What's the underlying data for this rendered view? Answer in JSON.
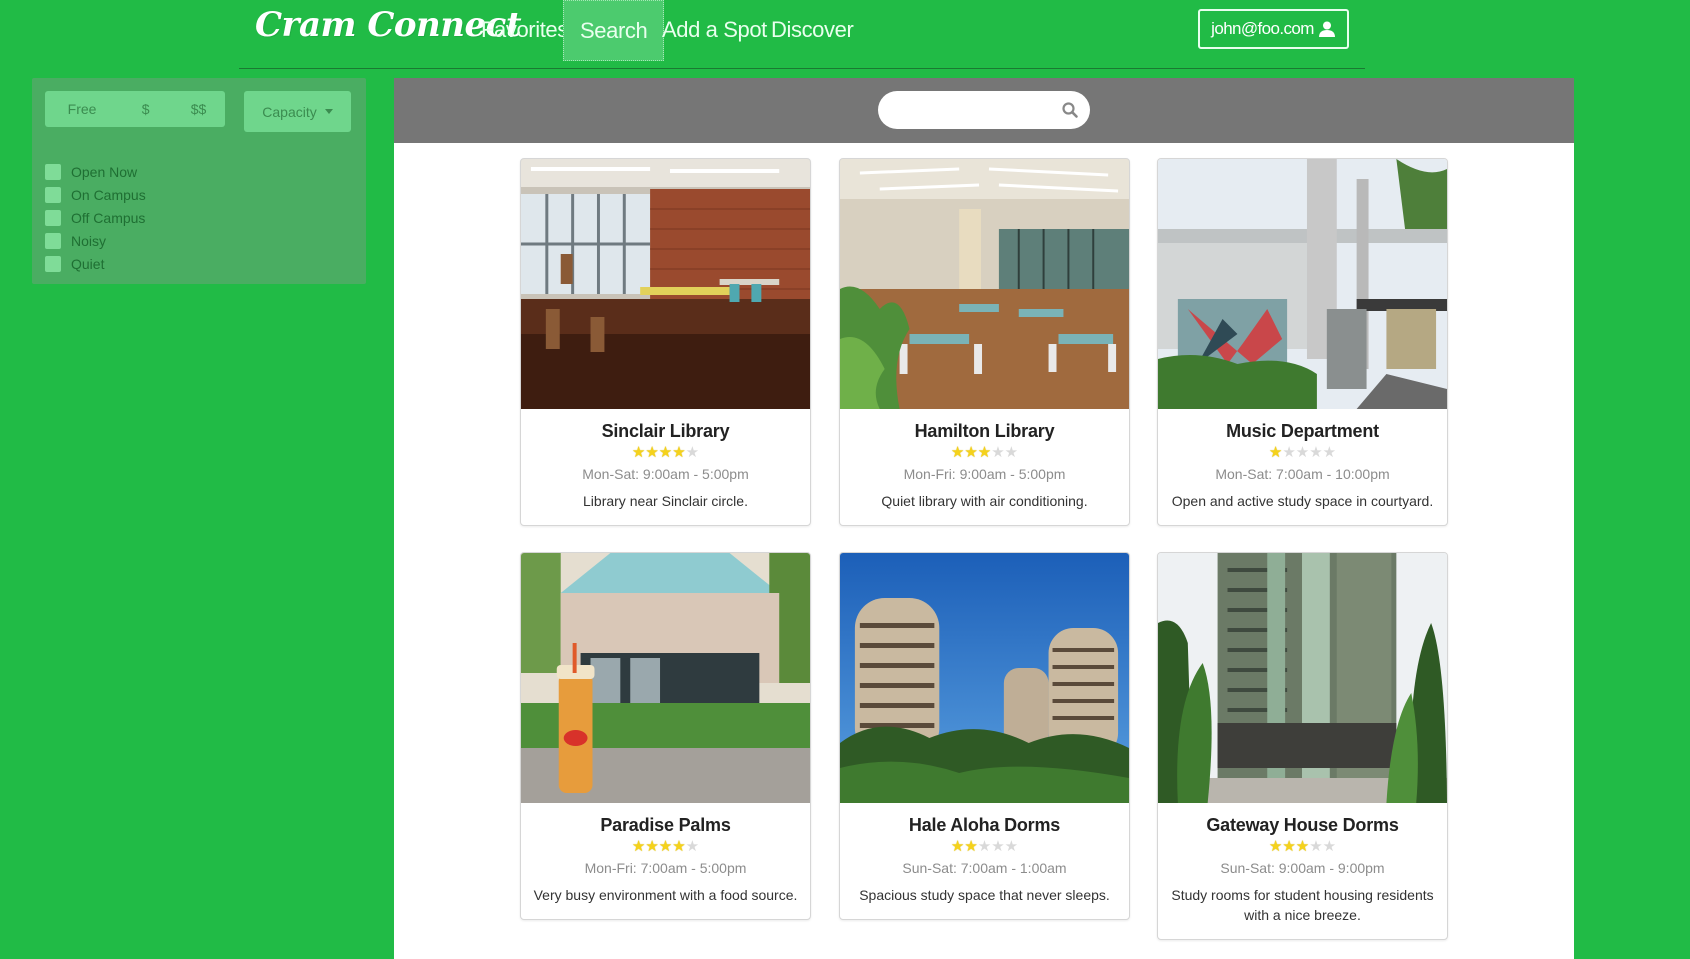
{
  "nav": {
    "brand": "Cram Connect",
    "items": [
      {
        "label": "Favorites"
      },
      {
        "label": "Search"
      },
      {
        "label": "Add a Spot"
      },
      {
        "label": "Discover"
      }
    ],
    "active": "Search",
    "user_email": "john@foo.com"
  },
  "sidebar": {
    "price": [
      "Free",
      "$",
      "$$"
    ],
    "capacity_label": "Capacity",
    "filters": [
      "Open Now",
      "On Campus",
      "Off Campus",
      "Noisy",
      "Quiet"
    ]
  },
  "search": {
    "placeholder": ""
  },
  "cards": [
    {
      "title": "Sinclair Library",
      "rating": 4,
      "hours": "Mon-Sat: 9:00am - 5:00pm",
      "description": "Library near Sinclair circle."
    },
    {
      "title": "Hamilton Library",
      "rating": 3,
      "hours": "Mon-Fri: 9:00am - 5:00pm",
      "description": "Quiet library with air conditioning."
    },
    {
      "title": "Music Department",
      "rating": 1,
      "hours": "Mon-Sat: 7:00am - 10:00pm",
      "description": "Open and active study space in courtyard."
    },
    {
      "title": "Paradise Palms",
      "rating": 4,
      "hours": "Mon-Fri: 7:00am - 5:00pm",
      "description": "Very busy environment with a food source."
    },
    {
      "title": "Hale Aloha Dorms",
      "rating": 2,
      "hours": "Sun-Sat: 7:00am - 1:00am",
      "description": "Spacious study space that never sleeps."
    },
    {
      "title": "Gateway House Dorms",
      "rating": 3,
      "hours": "Sun-Sat: 9:00am - 9:00pm",
      "description": "Study rooms for student housing residents with a nice breeze."
    }
  ],
  "rating_max": 5,
  "colors": {
    "page_bg": "#21bb46",
    "sidebar_bg": "#4aad62",
    "search_bar_bg": "#767676",
    "star_on": "#f5d21b",
    "star_off": "#d9d9d9"
  }
}
